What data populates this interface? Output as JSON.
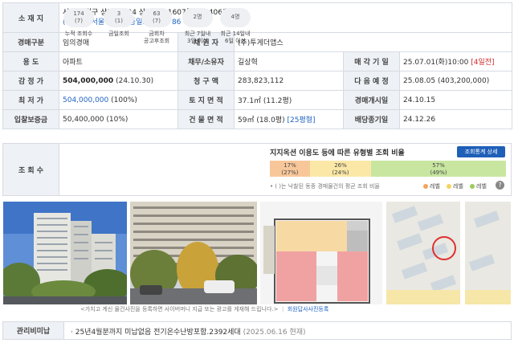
{
  "info": {
    "location": {
      "label": "소 재 지",
      "line1": "서울 노원구 상계동 624 상계주공 1607동 4층 406호",
      "line2_zip": "(01618)서울 노원구",
      "line2_road": "동일로227길 86"
    },
    "auction_type": {
      "label": "경매구분",
      "value": "임의경매"
    },
    "creditor": {
      "label": "채 권 자",
      "value": "(주)투게더앱스"
    },
    "usage": {
      "label": "용  도",
      "value": "아파트"
    },
    "debtor": {
      "label": "채무/소유자",
      "value": "길상혁"
    },
    "sale_date": {
      "label": "매 각 기 일",
      "value": "25.07.01(화)10:00",
      "dday": "[4일전]"
    },
    "appraisal": {
      "label": "감 정 가",
      "amount": "504,000,000",
      "date": "(24.10.30)"
    },
    "claim": {
      "label": "청 구 액",
      "value": "283,823,112"
    },
    "next": {
      "label": "다 음 예 정",
      "value": "25.08.05 (403,200,000)"
    },
    "minimum": {
      "label": "최 저 가",
      "amount": "504,000,000",
      "pct": "(100%)"
    },
    "land_area": {
      "label": "토 지 면 적",
      "value": "37.1㎡ (11.2평)"
    },
    "start_date": {
      "label": "경매개시일",
      "value": "24.10.15"
    },
    "deposit": {
      "label": "입찰보증금",
      "value": "50,400,000 (10%)"
    },
    "building_area": {
      "label": "건 물 면 적",
      "value": "59㎡ (18.0평)",
      "pyeong": "[25평형]"
    },
    "dividend": {
      "label": "배당종기일",
      "value": "24.12.26"
    }
  },
  "views": {
    "label": "조 회 수",
    "stats": [
      {
        "num": "174",
        "sub": "(7)",
        "caption": "누적 조회수"
      },
      {
        "num": "3",
        "sub": "(1)",
        "caption": "금일조회"
      },
      {
        "num": "63",
        "sub": "(7)",
        "caption": "금회차\n공고후조회"
      },
      {
        "num": "2명",
        "sub": "",
        "caption": "최근 7일내\n3일 이상"
      },
      {
        "num": "4명",
        "sub": "",
        "caption": "최근 14일내\n6일 이상"
      }
    ],
    "ratio_title": "지지옥션 이용도 등에 따른 유형별 조회 비율",
    "ratio_button": "조회통계 상세",
    "bars": [
      {
        "pct": "17%",
        "sub": "(27%)",
        "fraction": 0.17,
        "color": "#f7c79a"
      },
      {
        "pct": "26%",
        "sub": "(24%)",
        "fraction": 0.26,
        "color": "#fbe8a6"
      },
      {
        "pct": "57%",
        "sub": "(49%)",
        "fraction": 0.57,
        "color": "#c8e6a0"
      }
    ],
    "note": "• ( )는 낙찰된 동종 경매물건의 평균 조회 비율",
    "legend": [
      {
        "label": "레벨",
        "color": "#f5a35c"
      },
      {
        "label": "레벨",
        "color": "#f5d45c"
      },
      {
        "label": "레벨",
        "color": "#9ccc5a"
      }
    ],
    "help": "?"
  },
  "photos": {
    "caption": "<가치고 계신 물건사진을 등록하면 사이버머니 지급 또는 광고를 게재해 드립니다.>",
    "link": "회원답사사진등록"
  },
  "mgmt": {
    "label": "관리비미납",
    "value": "· 25년4월분까지 미납없음 전기온수난방포함.2392세대",
    "date": "(2025.06.16 현재)"
  }
}
